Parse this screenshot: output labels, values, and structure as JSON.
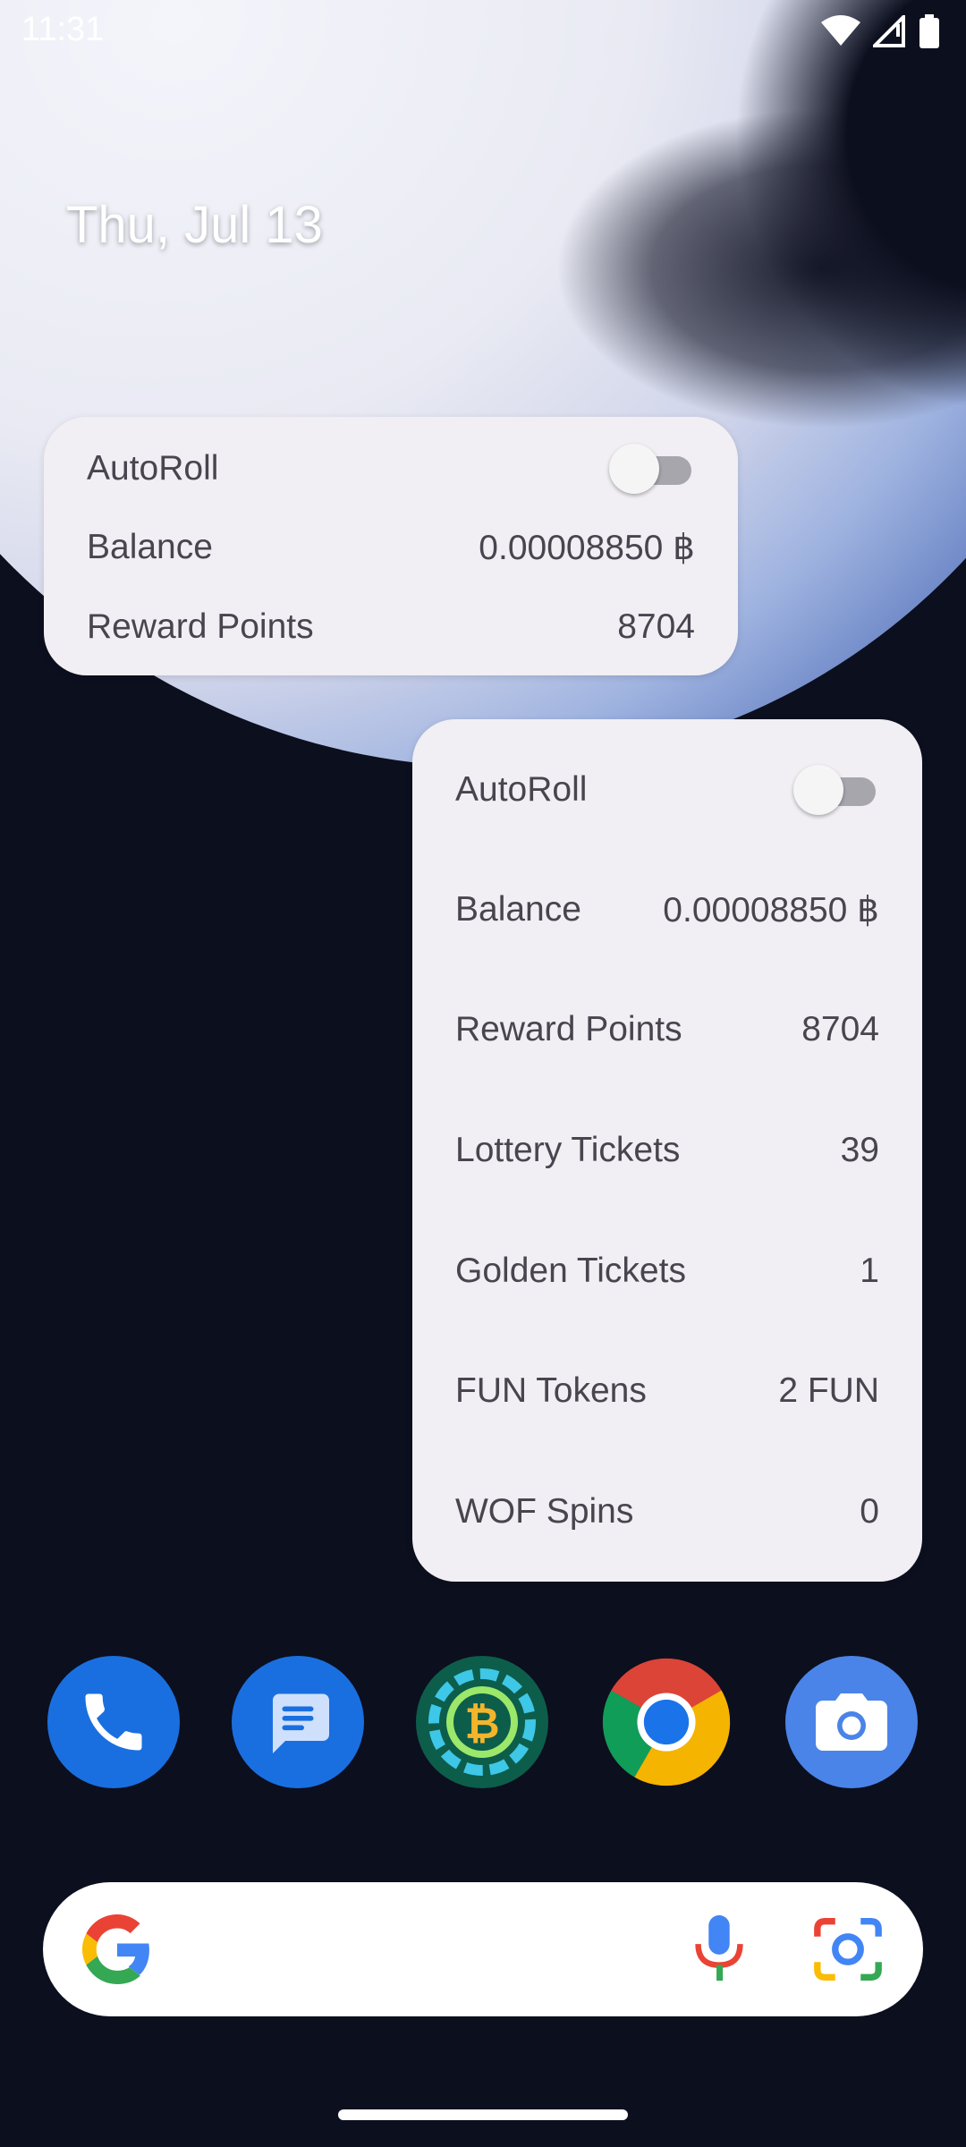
{
  "status_bar": {
    "time": "11:31"
  },
  "home": {
    "date": "Thu, Jul 13"
  },
  "widget_small": {
    "rows": [
      {
        "label": "AutoRoll"
      },
      {
        "label": "Balance",
        "value": "0.00008850 ฿"
      },
      {
        "label": "Reward Points",
        "value": "8704"
      }
    ],
    "autoroll_on": false
  },
  "widget_large": {
    "rows": [
      {
        "label": "AutoRoll"
      },
      {
        "label": "Balance",
        "value": "0.00008850 ฿"
      },
      {
        "label": "Reward Points",
        "value": "8704"
      },
      {
        "label": "Lottery Tickets",
        "value": "39"
      },
      {
        "label": "Golden Tickets",
        "value": "1"
      },
      {
        "label": "FUN Tokens",
        "value": "2 FUN"
      },
      {
        "label": "WOF Spins",
        "value": "0"
      }
    ],
    "autoroll_on": false
  },
  "dock": {
    "apps": [
      {
        "icon": "phone-icon",
        "color": "#1a6fe0"
      },
      {
        "icon": "messages-icon",
        "color": "#1a6fe0"
      },
      {
        "icon": "bitcoin-app-icon",
        "color": "#0d5d4b"
      },
      {
        "icon": "chrome-icon",
        "color": "#ffffff"
      },
      {
        "icon": "camera-icon",
        "color": "#4a84e8"
      }
    ]
  },
  "search": {
    "logo": "google-logo-icon",
    "mic": "mic-icon",
    "lens": "lens-icon"
  }
}
